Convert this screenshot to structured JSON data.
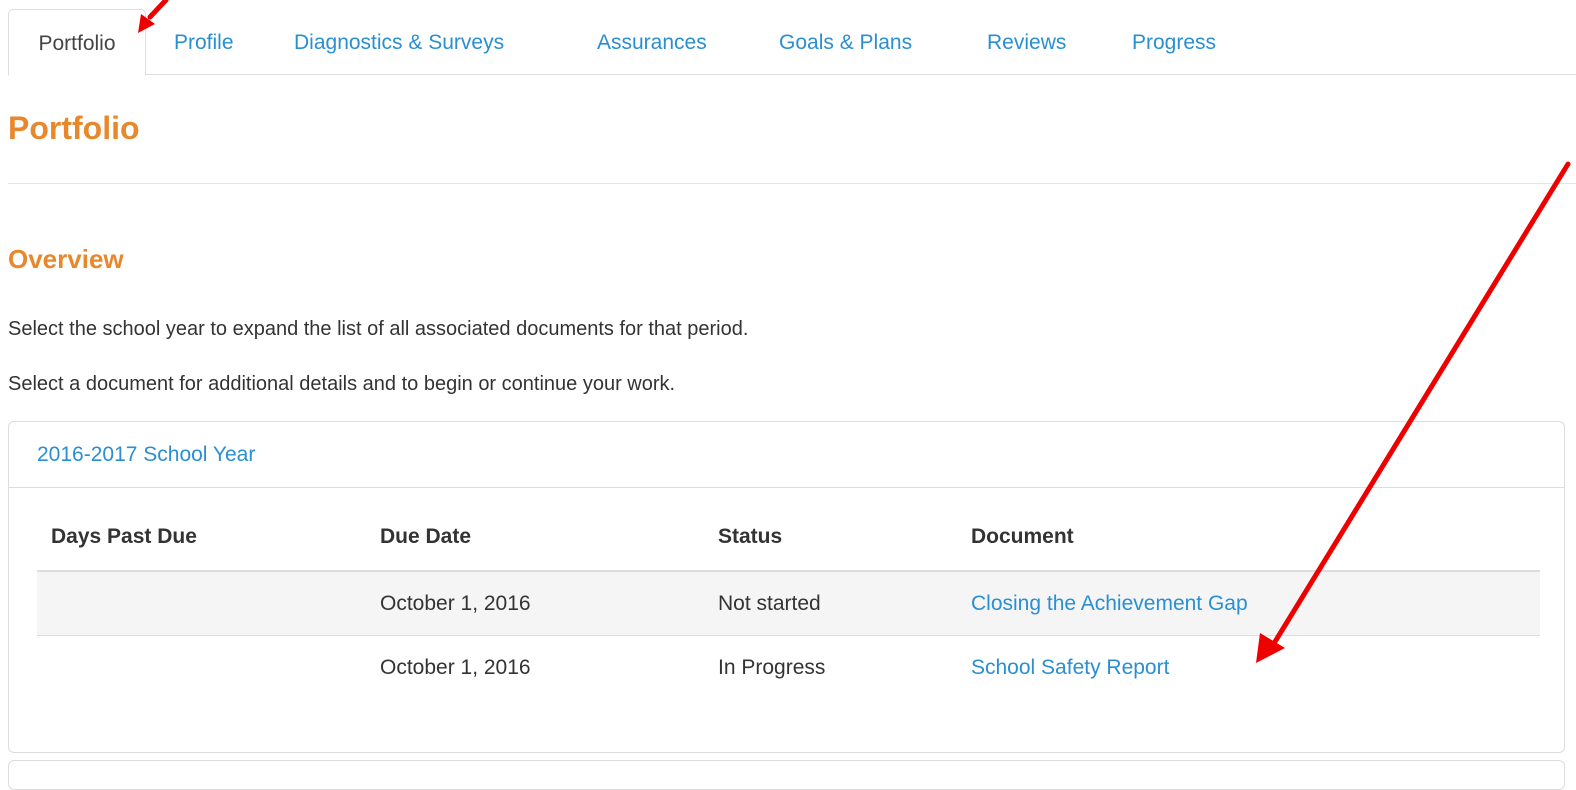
{
  "tabs": [
    {
      "label": "Portfolio",
      "active": true
    },
    {
      "label": "Profile"
    },
    {
      "label": "Diagnostics & Surveys"
    },
    {
      "label": "Assurances"
    },
    {
      "label": "Goals & Plans"
    },
    {
      "label": "Reviews"
    },
    {
      "label": "Progress"
    }
  ],
  "page": {
    "title": "Portfolio"
  },
  "overview": {
    "title": "Overview",
    "instructions": [
      "Select the school year to expand the list of all associated documents for that period.",
      "Select a document for additional details and to begin or continue your work."
    ]
  },
  "school_year": {
    "label": "2016-2017 School Year",
    "columns": [
      "Days Past Due",
      "Due Date",
      "Status",
      "Document"
    ],
    "rows": [
      {
        "days_past_due": "",
        "due_date": "October 1, 2016",
        "status": "Not started",
        "document": "Closing the Achievement Gap"
      },
      {
        "days_past_due": "",
        "due_date": "October 1, 2016",
        "status": "In Progress",
        "document": "School Safety Report"
      }
    ]
  },
  "colors": {
    "accent_orange": "#e8882c",
    "link_blue": "#2a8fd1",
    "annotation_red": "#ee0000"
  }
}
